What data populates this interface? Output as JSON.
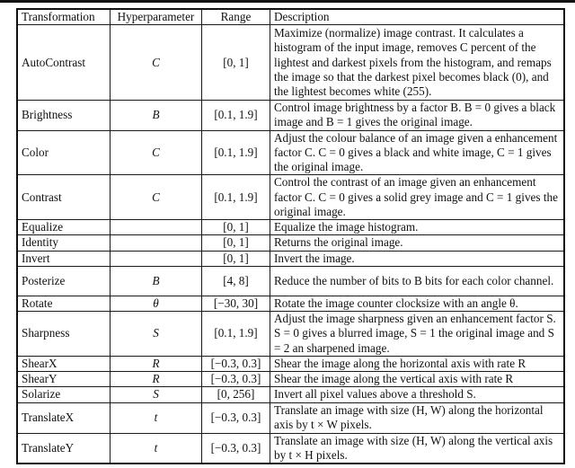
{
  "table": {
    "headers": [
      "Transformation",
      "Hyperparameter",
      "Range",
      "Description"
    ],
    "rows": [
      {
        "transformation": "AutoContrast",
        "hyperparameter": "C",
        "range": "[0, 1]",
        "description": "Maximize (normalize) image contrast. It calculates a histogram of the input image, removes C percent of the lightest and darkest pixels from the histogram, and remaps the image so that the darkest pixel becomes black (0), and the lightest becomes white (255)."
      },
      {
        "transformation": "Brightness",
        "hyperparameter": "B",
        "range": "[0.1, 1.9]",
        "description": "Control image brightness by a factor B. B = 0 gives a black image and B = 1 gives the original image."
      },
      {
        "transformation": "Color",
        "hyperparameter": "C",
        "range": "[0.1, 1.9]",
        "description": "Adjust the colour balance of an image given a enhancement factor C. C = 0 gives a black and white image, C = 1 gives the original image."
      },
      {
        "transformation": "Contrast",
        "hyperparameter": "C",
        "range": "[0.1, 1.9]",
        "description": "Control the contrast of an image given an enhancement factor C. C = 0 gives a solid grey image and C = 1 gives the original image."
      },
      {
        "transformation": "Equalize",
        "hyperparameter": "",
        "range": "[0, 1]",
        "description": "Equalize the image histogram."
      },
      {
        "transformation": "Identity",
        "hyperparameter": "",
        "range": "[0, 1]",
        "description": "Returns the original image."
      },
      {
        "transformation": "Invert",
        "hyperparameter": "",
        "range": "[0, 1]",
        "description": "Invert the image."
      },
      {
        "transformation": "Posterize",
        "hyperparameter": "B",
        "range": "[4, 8]",
        "description": "Reduce the number of bits to B bits for each color channel."
      },
      {
        "transformation": "Rotate",
        "hyperparameter": "θ",
        "range": "[−30, 30]",
        "description": "Rotate the image counter clocksize with an angle θ."
      },
      {
        "transformation": "Sharpness",
        "hyperparameter": "S",
        "range": "[0.1, 1.9]",
        "description": "Adjust the image sharpness given an enhancement factor S. S = 0 gives a blurred image, S = 1 the original image and S = 2 an sharpened image."
      },
      {
        "transformation": "ShearX",
        "hyperparameter": "R",
        "range": "[−0.3, 0.3]",
        "description": "Shear the image along the horizontal axis with rate R"
      },
      {
        "transformation": "ShearY",
        "hyperparameter": "R",
        "range": "[−0.3, 0.3]",
        "description": "Shear the image along the vertical axis with rate R"
      },
      {
        "transformation": "Solarize",
        "hyperparameter": "S",
        "range": "[0, 256]",
        "description": "Invert all pixel values above a threshold S."
      },
      {
        "transformation": "TranslateX",
        "hyperparameter": "t",
        "range": "[−0.3, 0.3]",
        "description": "Translate an image with size (H, W) along the horizontal axis by t × W pixels."
      },
      {
        "transformation": "TranslateY",
        "hyperparameter": "t",
        "range": "[−0.3, 0.3]",
        "description": "Translate an image with size (H, W) along the vertical axis by t × H pixels."
      }
    ]
  }
}
